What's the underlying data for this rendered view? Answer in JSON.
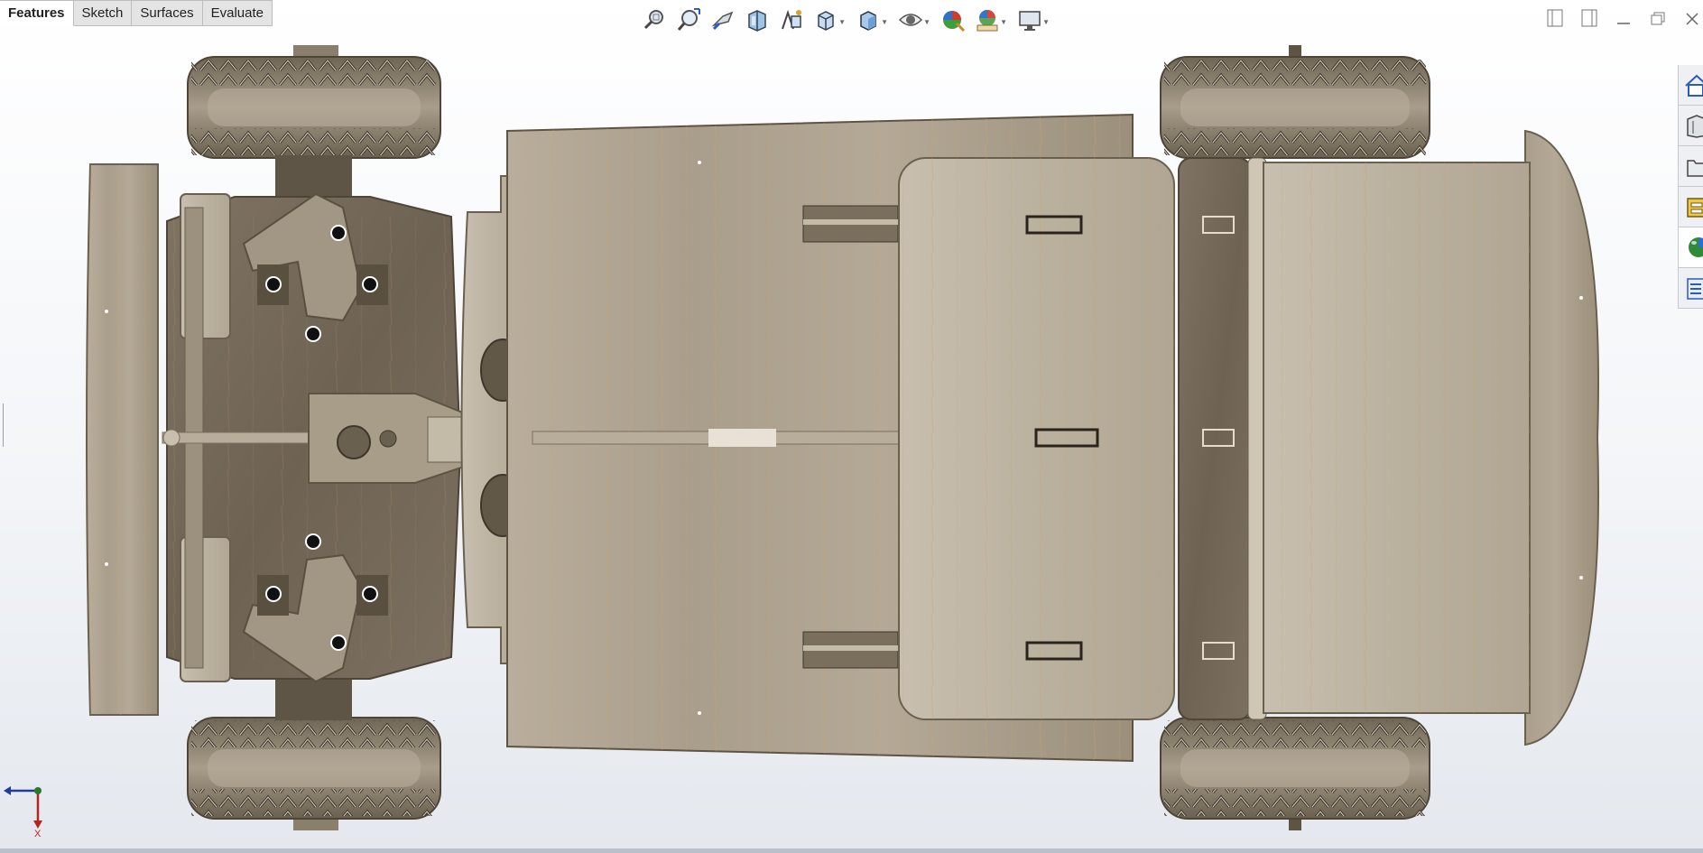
{
  "command_manager": {
    "tabs": [
      {
        "label": "Features",
        "active": true
      },
      {
        "label": "Sketch",
        "active": false
      },
      {
        "label": "Surfaces",
        "active": false
      },
      {
        "label": "Evaluate",
        "active": false
      }
    ]
  },
  "heads_up_toolbar": {
    "tools": [
      {
        "icon": "zoom-to-fit-icon"
      },
      {
        "icon": "zoom-to-area-icon"
      },
      {
        "icon": "previous-view-icon"
      },
      {
        "icon": "section-view-icon"
      },
      {
        "icon": "dynamic-annotation-icon"
      },
      {
        "icon": "view-orientation-icon"
      },
      {
        "icon": "display-style-icon"
      },
      {
        "icon": "hide-show-items-icon"
      },
      {
        "icon": "edit-appearance-icon"
      },
      {
        "icon": "apply-scene-icon"
      },
      {
        "icon": "view-settings-icon"
      }
    ]
  },
  "task_pane": {
    "tabs": [
      {
        "icon": "home-icon"
      },
      {
        "icon": "design-library-icon"
      },
      {
        "icon": "file-explorer-icon"
      },
      {
        "icon": "view-palette-icon"
      },
      {
        "icon": "appearances-icon"
      },
      {
        "icon": "custom-properties-icon"
      }
    ]
  },
  "triad": {
    "axis_label": "X"
  },
  "colors": {
    "wood_light": "#c9bfae",
    "wood_mid": "#a89c88",
    "wood_dark": "#7a6e5d",
    "tire": "#8f8472",
    "accent_blue": "#1f3d9c",
    "accent_red": "#b8241c"
  }
}
